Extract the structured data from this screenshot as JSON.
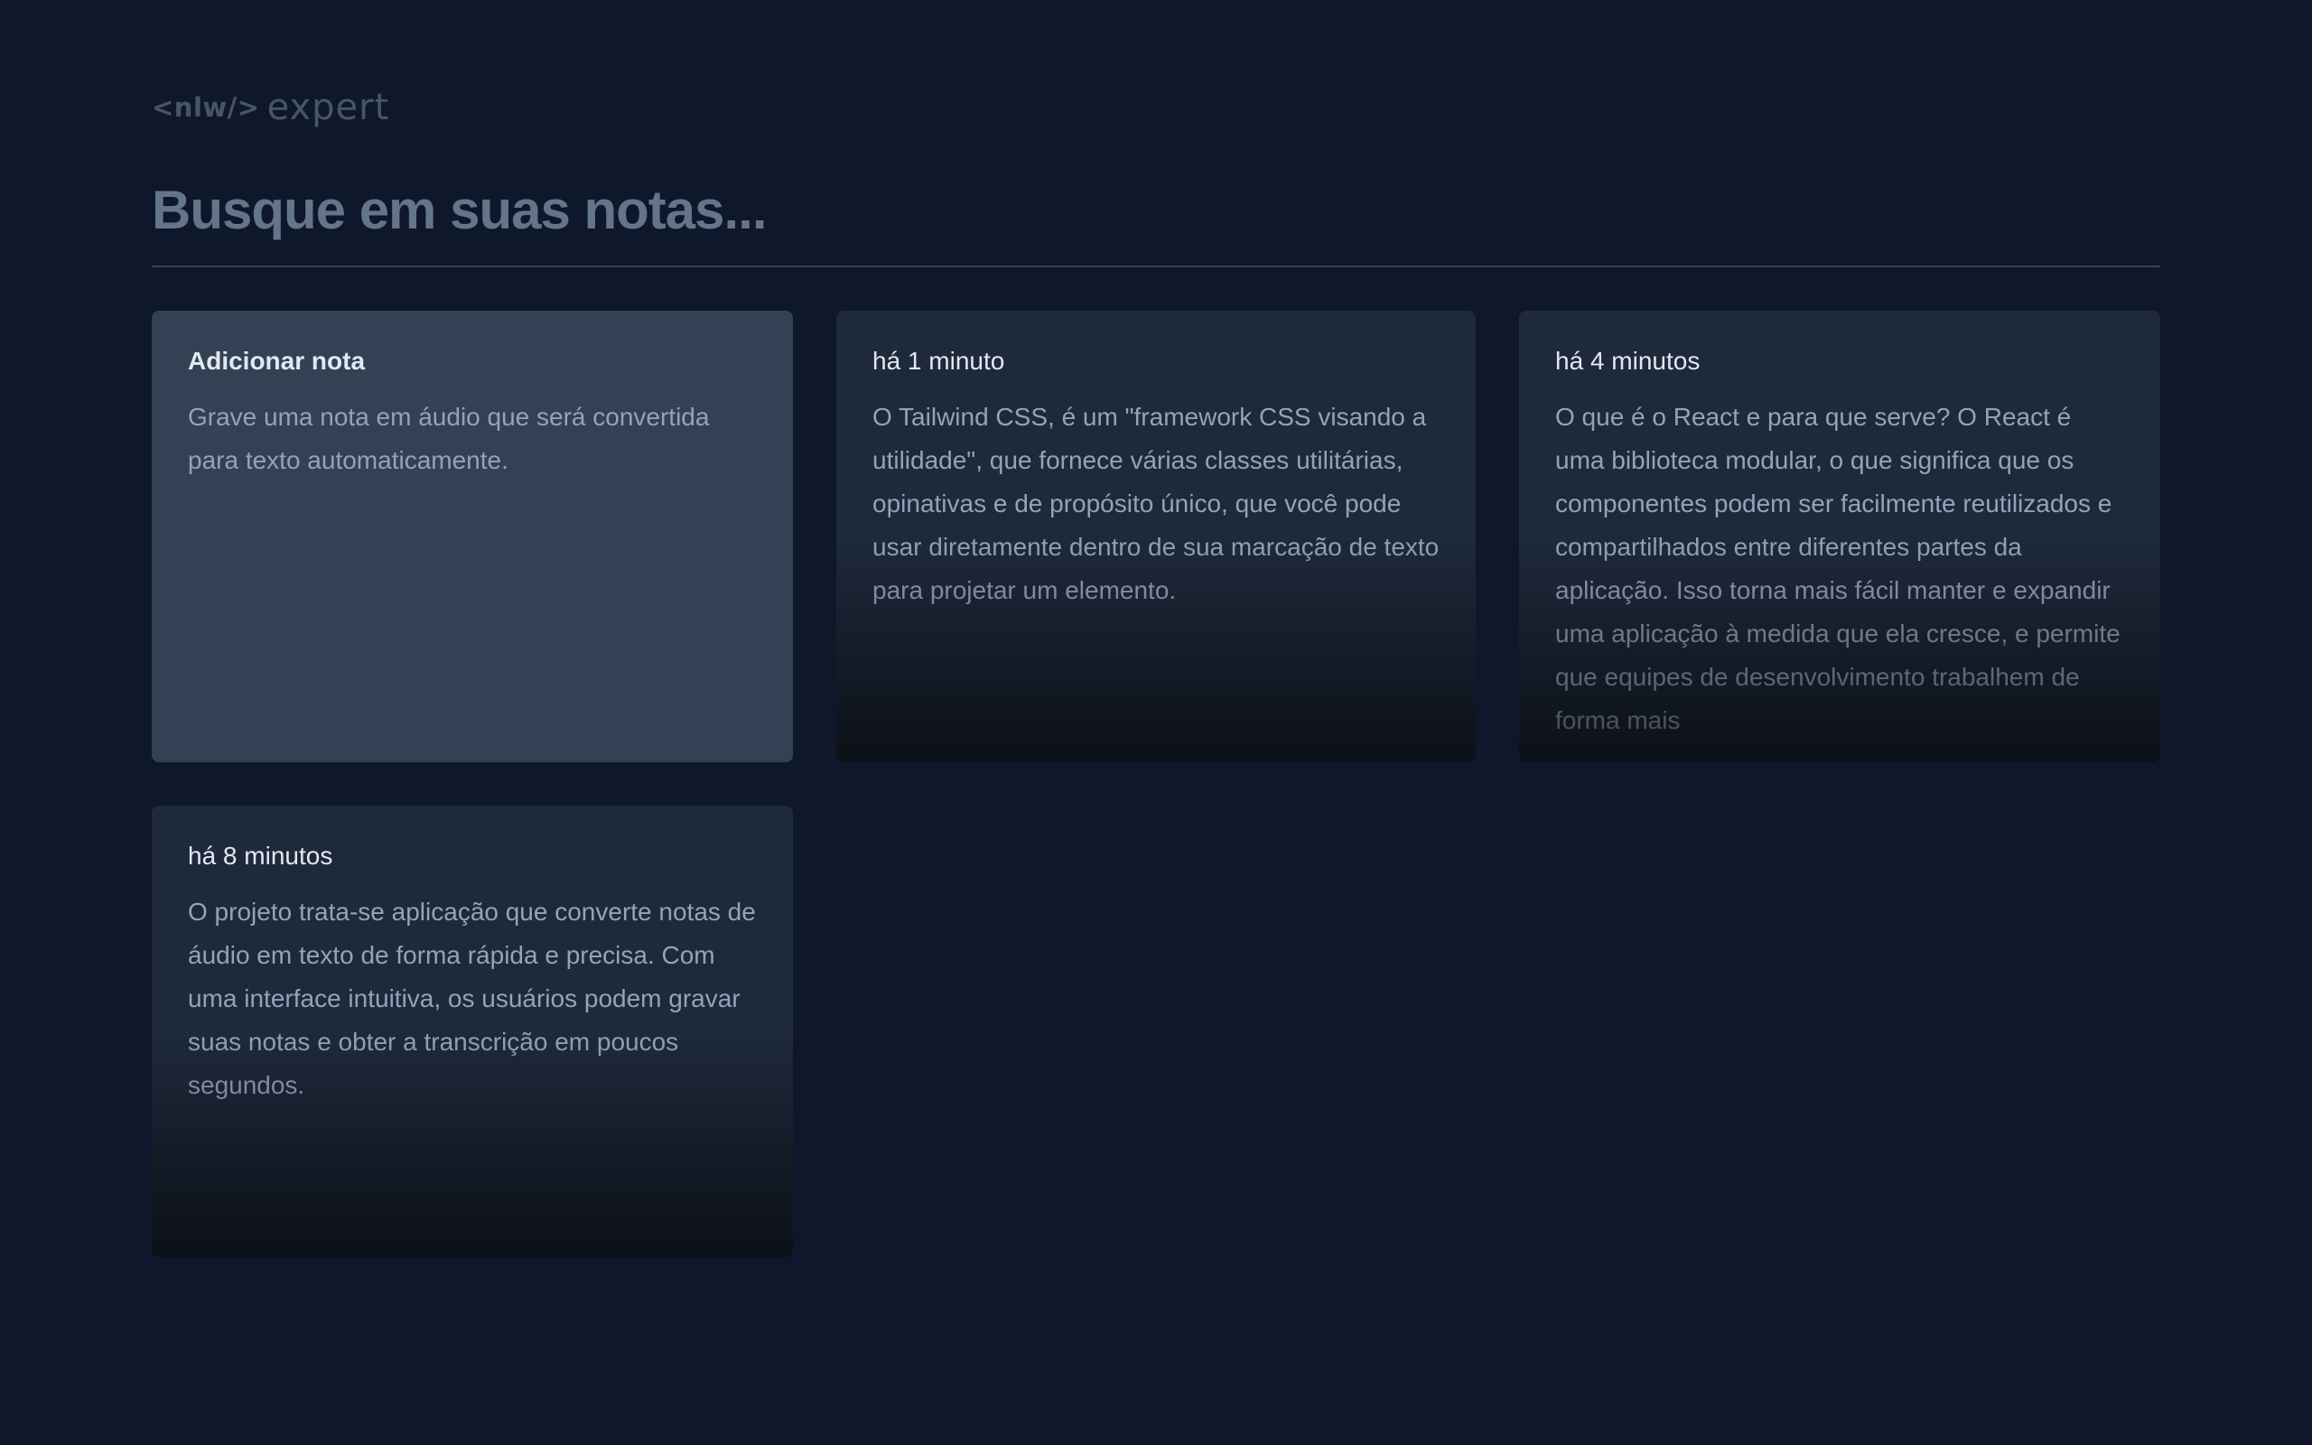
{
  "header": {
    "logo_mark": "<nlw/>",
    "logo_word": "expert"
  },
  "search": {
    "placeholder": "Busque em suas notas..."
  },
  "add_card": {
    "title": "Adicionar nota",
    "description": "Grave uma nota em áudio que será convertida para texto automaticamente."
  },
  "notes": [
    {
      "time": "há 1 minuto",
      "content": "O Tailwind CSS, é um \"framework CSS visando a utilidade\", que fornece várias classes utilitárias, opinativas e de propósito único, que você pode usar diretamente dentro de sua marcação de texto para projetar um elemento."
    },
    {
      "time": "há 4 minutos",
      "content": "O que é o React e para que serve? O React é uma biblioteca modular, o que significa que os componentes podem ser facilmente reutilizados e compartilhados entre diferentes partes da aplicação. Isso torna mais fácil manter e expandir uma aplicação à medida que ela cresce, e permite que equipes de desenvolvimento trabalhem de forma mais"
    },
    {
      "time": "há 8 minutos",
      "content": "O projeto trata-se aplicação que converte notas de áudio em texto de forma rápida e precisa. Com uma interface intuitiva, os usuários podem gravar suas notas e obter a transcrição em poucos segundos."
    }
  ]
}
